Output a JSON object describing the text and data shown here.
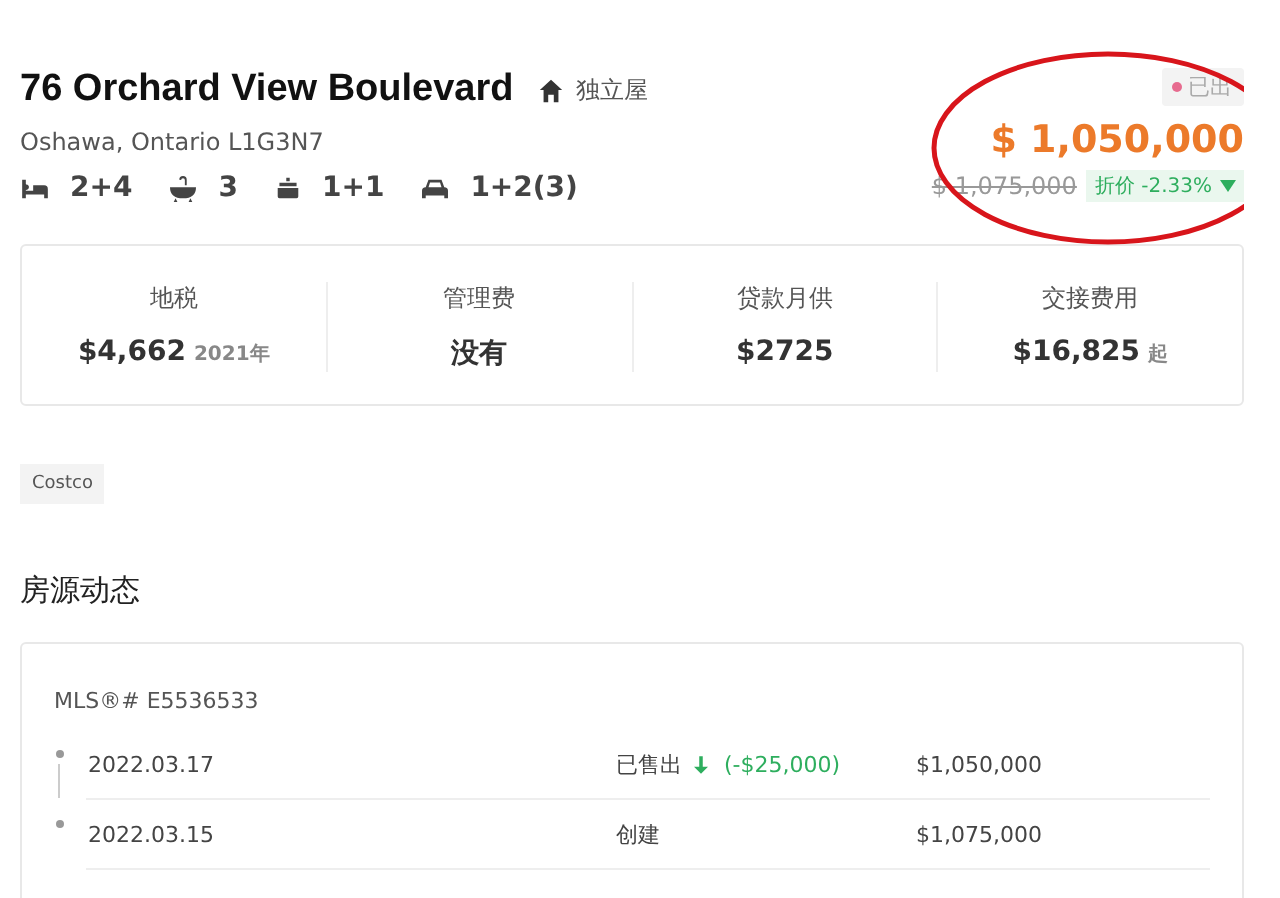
{
  "listing": {
    "title": "76 Orchard View Boulevard",
    "type": "独立屋",
    "address": "Oshawa, Ontario L1G3N7",
    "features": [
      {
        "kind": "bed",
        "value": "2+4"
      },
      {
        "kind": "bath",
        "value": "3"
      },
      {
        "kind": "kitchen",
        "value": "1+1"
      },
      {
        "kind": "parking",
        "value": "1+2(3)"
      }
    ],
    "status": "已出",
    "price": "$ 1,050,000",
    "original_price": "$ 1,075,000",
    "discount": "折价 -2.33%"
  },
  "costs": [
    {
      "label": "地税",
      "value": "$4,662",
      "note": "2021年"
    },
    {
      "label": "管理费",
      "value": "没有"
    },
    {
      "label": "贷款月供",
      "value": "$2725"
    },
    {
      "label": "交接费用",
      "value": "$16,825",
      "note": "起"
    }
  ],
  "tags": [
    "Costco"
  ],
  "history": {
    "title": "房源动态",
    "mls": "MLS®# E5536533",
    "events": [
      {
        "date": "2022.03.17",
        "event": "已售出",
        "change": "(-$25,000)",
        "price": "$1,050,000"
      },
      {
        "date": "2022.03.15",
        "event": "创建",
        "price": "$1,075,000"
      }
    ]
  }
}
